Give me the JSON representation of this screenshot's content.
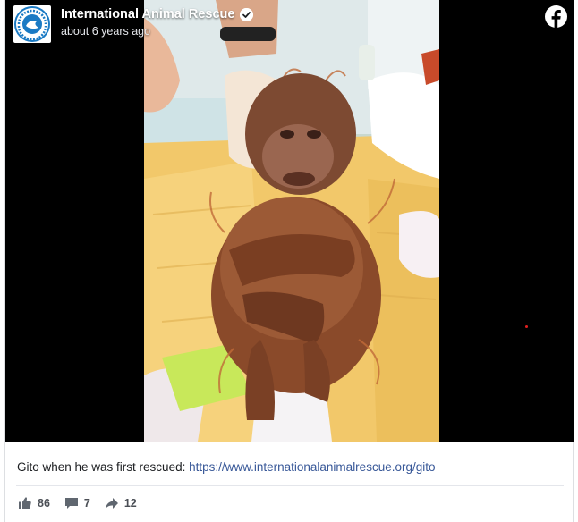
{
  "post": {
    "page_name": "International Animal Rescue",
    "timestamp": "about 6 years ago",
    "caption_text": "Gito when he was first rescued: ",
    "caption_link": "https://www.internationalanimalrescue.org/gito",
    "image_subject": "baby-orangutan-photo",
    "avatar_text": "INTERNATIONAL ANIMAL RESCUE"
  },
  "stats": {
    "likes": "86",
    "comments": "7",
    "shares": "12"
  },
  "colors": {
    "brand_blue": "#1a7ac4",
    "link": "#385898",
    "facebook": "#ffffff",
    "media_bg": "#000000"
  },
  "icons": [
    "verified-badge-icon",
    "facebook-logo-icon",
    "like-icon",
    "comment-icon",
    "share-icon"
  ]
}
